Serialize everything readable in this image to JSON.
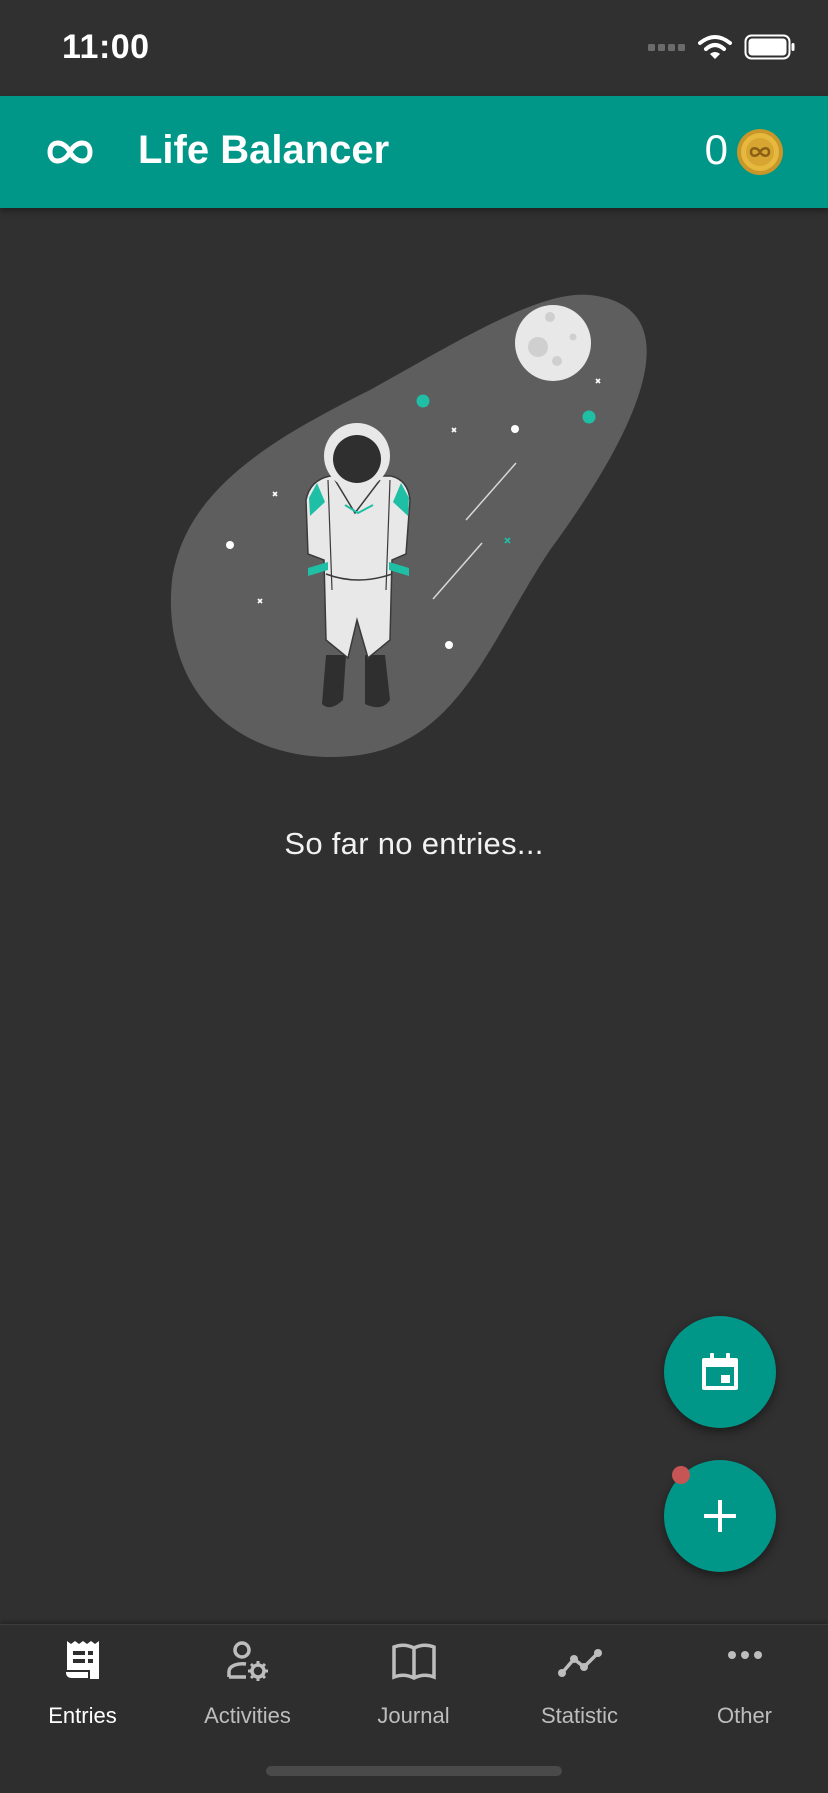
{
  "status_bar": {
    "time": "11:00",
    "icons": [
      "signal-icon",
      "wifi-icon",
      "battery-icon"
    ]
  },
  "app_bar": {
    "title": "Life Balancer",
    "coin_count": "0",
    "logo_icon": "infinity-icon",
    "coin_icon": "coin-icon"
  },
  "empty_state": {
    "message": "So far no entries...",
    "illustration": "astronaut-in-space"
  },
  "fabs": {
    "calendar_icon": "calendar-icon",
    "add_icon": "plus-icon"
  },
  "bottom_nav": {
    "items": [
      {
        "label": "Entries",
        "icon": "receipt-icon",
        "active": true
      },
      {
        "label": "Activities",
        "icon": "user-gear-icon",
        "active": false
      },
      {
        "label": "Journal",
        "icon": "book-icon",
        "active": false
      },
      {
        "label": "Statistic",
        "icon": "line-chart-icon",
        "active": false
      },
      {
        "label": "Other",
        "icon": "more-horizontal-icon",
        "active": false
      }
    ]
  },
  "colors": {
    "primary": "#009688",
    "background": "#303030",
    "accent_teal": "#1fbfa6",
    "badge": "#c75555"
  }
}
